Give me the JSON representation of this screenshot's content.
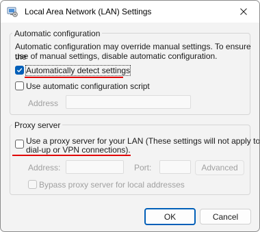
{
  "window": {
    "title": "Local Area Network (LAN) Settings"
  },
  "automatic": {
    "heading": "Automatic configuration",
    "description_line1": "Automatic configuration may override manual settings.  To ensure the",
    "description_line2": "use of manual settings, disable automatic configuration.",
    "auto_detect": {
      "label": "Automatically detect settings",
      "checked": true
    },
    "use_script": {
      "label": "Use automatic configuration script",
      "checked": false
    },
    "address_label": "Address",
    "address_value": ""
  },
  "proxy": {
    "heading": "Proxy server",
    "use_proxy_line1": "Use a proxy server for your LAN (These settings will not apply to",
    "use_proxy_line2": "dial-up or VPN connections).",
    "use_proxy_checked": false,
    "address_label": "Address:",
    "address_value": "",
    "port_label": "Port:",
    "port_value": "",
    "advanced_label": "Advanced",
    "bypass_label": "Bypass proxy server for local addresses",
    "bypass_checked": false
  },
  "buttons": {
    "ok": "OK",
    "cancel": "Cancel"
  },
  "colors": {
    "accent": "#005fb8",
    "annotation": "#e00000"
  },
  "icons": {
    "app": "network-settings-icon",
    "close": "close-icon",
    "check": "checkmark-icon"
  }
}
